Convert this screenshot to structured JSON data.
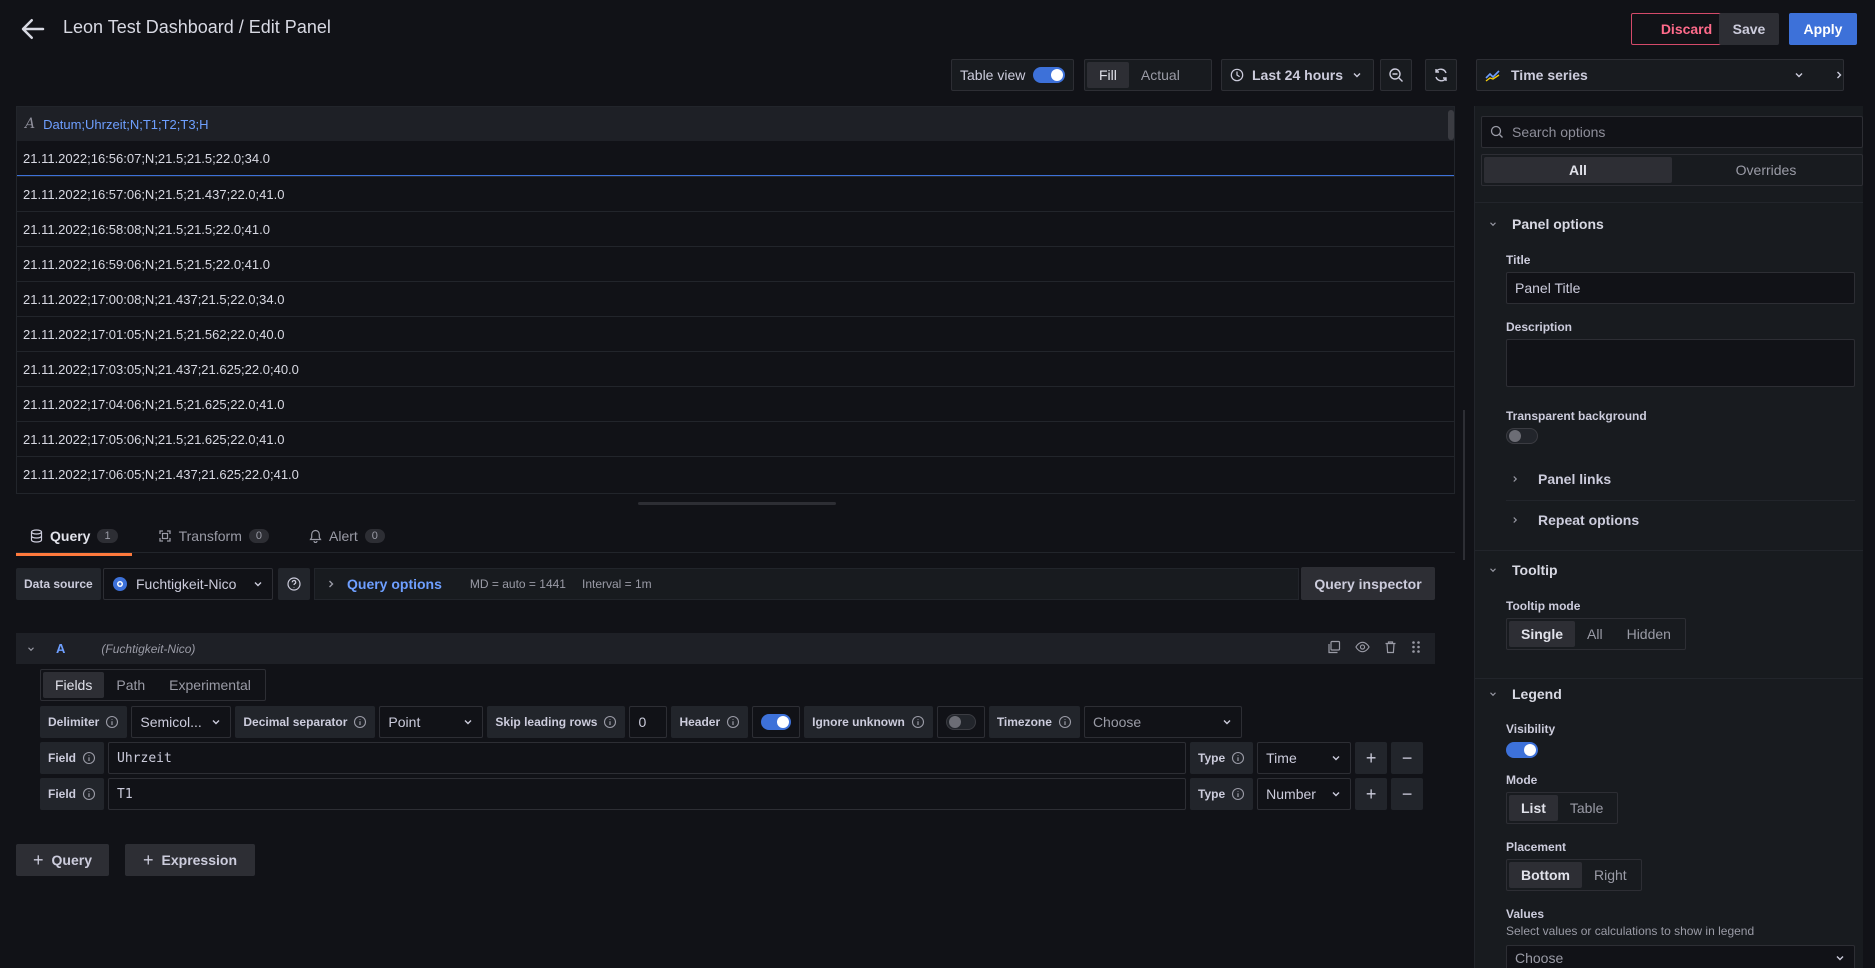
{
  "header": {
    "title": "Leon Test Dashboard / Edit Panel",
    "discard": "Discard",
    "save": "Save",
    "apply": "Apply"
  },
  "toolbar": {
    "table_view": "Table view",
    "fill": "Fill",
    "actual": "Actual",
    "time_range": "Last 24 hours",
    "visualization": "Time series"
  },
  "table": {
    "header": "Datum;Uhrzeit;N;T1;T2;T3;H",
    "rows": [
      "21.11.2022;16:56:07;N;21.5;21.5;22.0;34.0",
      "21.11.2022;16:57:06;N;21.5;21.437;22.0;41.0",
      "21.11.2022;16:58:08;N;21.5;21.5;22.0;41.0",
      "21.11.2022;16:59:06;N;21.5;21.5;22.0;41.0",
      "21.11.2022;17:00:08;N;21.437;21.5;22.0;34.0",
      "21.11.2022;17:01:05;N;21.5;21.562;22.0;40.0",
      "21.11.2022;17:03:05;N;21.437;21.625;22.0;40.0",
      "21.11.2022;17:04:06;N;21.5;21.625;22.0;41.0",
      "21.11.2022;17:05:06;N;21.5;21.625;22.0;41.0",
      "21.11.2022;17:06:05;N;21.437;21.625;22.0;41.0"
    ]
  },
  "tabs": [
    {
      "label": "Query",
      "count": "1"
    },
    {
      "label": "Transform",
      "count": "0"
    },
    {
      "label": "Alert",
      "count": "0"
    }
  ],
  "datasource": {
    "label": "Data source",
    "value": "Fuchtigkeit-Nico",
    "query_options": "Query options",
    "md": "MD = auto = 1441",
    "interval": "Interval = 1m",
    "inspector": "Query inspector"
  },
  "query": {
    "letter": "A",
    "ds": "(Fuchtigkeit-Nico)",
    "subtabs": [
      "Fields",
      "Path",
      "Experimental"
    ],
    "delimiter_label": "Delimiter",
    "delimiter_value": "Semicol...",
    "decimal_label": "Decimal separator",
    "decimal_value": "Point",
    "skip_label": "Skip leading rows",
    "skip_value": "0",
    "header_label": "Header",
    "ignore_label": "Ignore unknown",
    "timezone_label": "Timezone",
    "timezone_value": "Choose",
    "fields": [
      {
        "label": "Field",
        "value": "Uhrzeit",
        "type_label": "Type",
        "type": "Time"
      },
      {
        "label": "Field",
        "value": "T1",
        "type_label": "Type",
        "type": "Number"
      }
    ],
    "add_query": "Query",
    "add_expression": "Expression"
  },
  "options": {
    "search_placeholder": "Search options",
    "all": "All",
    "overrides": "Overrides",
    "panel_options": "Panel options",
    "title_label": "Title",
    "title_value": "Panel Title",
    "description_label": "Description",
    "transparent_label": "Transparent background",
    "panel_links": "Panel links",
    "repeat_options": "Repeat options",
    "tooltip": "Tooltip",
    "tooltip_mode": "Tooltip mode",
    "tooltip_options": [
      "Single",
      "All",
      "Hidden"
    ],
    "legend": "Legend",
    "visibility": "Visibility",
    "mode": "Mode",
    "mode_options": [
      "List",
      "Table"
    ],
    "placement": "Placement",
    "placement_options": [
      "Bottom",
      "Right"
    ],
    "values": "Values",
    "values_desc": "Select values or calculations to show in legend",
    "values_select": "Choose"
  }
}
